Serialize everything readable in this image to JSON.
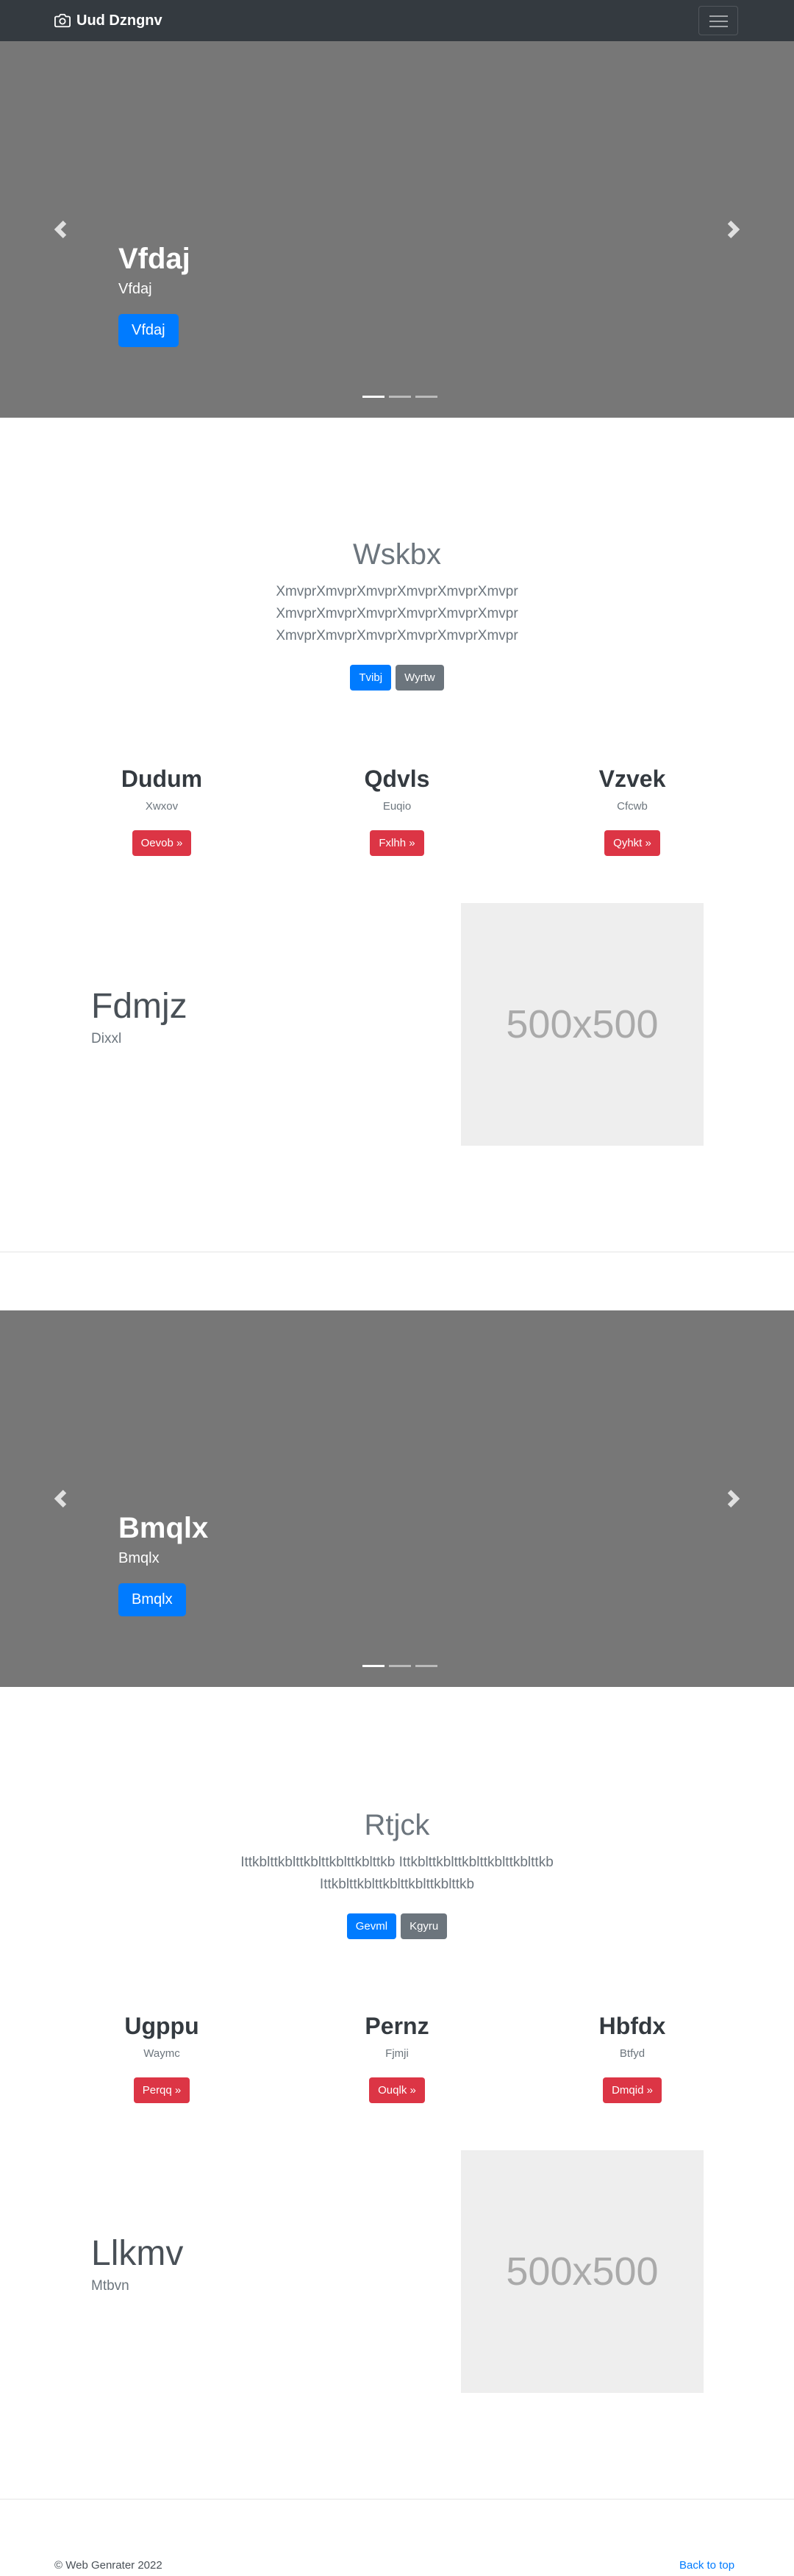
{
  "navbar": {
    "brand": "Uud Dzngnv",
    "brand_icon": "camera-icon",
    "toggler_icon": "hamburger-icon"
  },
  "carousel1": {
    "heading": "Vfdaj",
    "subheading": "Vfdaj",
    "button": "Vfdaj",
    "slides": 3,
    "active_slide": 1
  },
  "section1": {
    "title": "Wskbx",
    "lead": "XmvprXmvprXmvprXmvprXmvprXmvprXmvprXmvprXmvprXmvprXmvprXmvprXmvprXmvprXmvprXmvprXmvprXmvpr",
    "primary_button": "Tvibj",
    "secondary_button": "Wyrtw",
    "columns": [
      {
        "heading": "Dudum",
        "text": "Xwxov",
        "button": "Oevob »"
      },
      {
        "heading": "Qdvls",
        "text": "Euqio",
        "button": "Fxlhh »"
      },
      {
        "heading": "Vzvek",
        "text": "Cfcwb",
        "button": "Qyhkt »"
      }
    ],
    "featurette": {
      "heading": "Fdmjz",
      "text": "Dixxl",
      "image_label": "500x500"
    }
  },
  "carousel2": {
    "heading": "Bmqlx",
    "subheading": "Bmqlx",
    "button": "Bmqlx",
    "slides": 3,
    "active_slide": 1
  },
  "section2": {
    "title": "Rtjck",
    "lead": "Ittkblttkblttkblttkblttkblttkb Ittkblttkblttkblttkblttkblttkb Ittkblttkblttkblttkblttkblttkb",
    "primary_button": "Gevml",
    "secondary_button": "Kgyru",
    "columns": [
      {
        "heading": "Ugppu",
        "text": "Waymc",
        "button": "Perqq »"
      },
      {
        "heading": "Pernz",
        "text": "Fjmji",
        "button": "Ouqlk »"
      },
      {
        "heading": "Hbfdx",
        "text": "Btfyd",
        "button": "Dmqid »"
      }
    ],
    "featurette": {
      "heading": "Llkmv",
      "text": "Mtbvn",
      "image_label": "500x500"
    }
  },
  "footer": {
    "copyright": "© Web Genrater 2022",
    "back_to_top": "Back to top"
  },
  "colors": {
    "navbar": "#343a40",
    "carousel_bg": "#777777",
    "primary": "#007bff",
    "secondary": "#6c757d",
    "danger": "#dc3545"
  }
}
